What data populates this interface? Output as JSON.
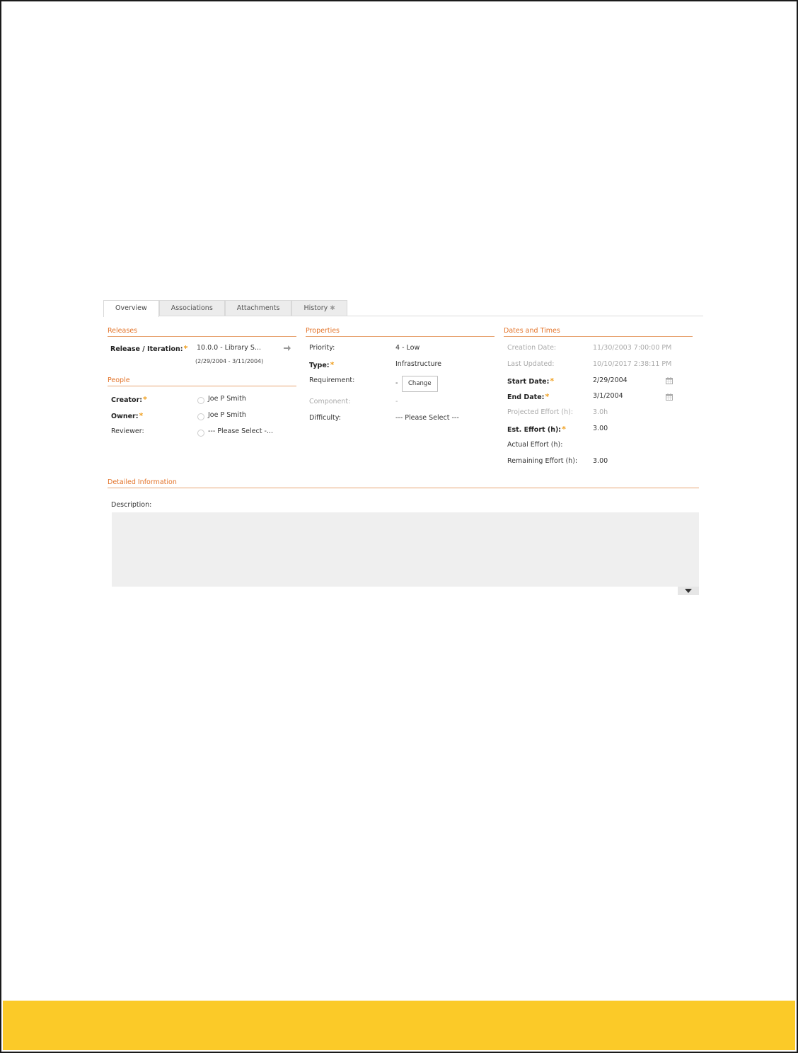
{
  "tabs": [
    {
      "label": "Overview",
      "active": true
    },
    {
      "label": "Associations",
      "active": false
    },
    {
      "label": "Attachments",
      "active": false
    },
    {
      "label": "History",
      "active": false
    }
  ],
  "releases": {
    "title": "Releases",
    "release_label": "Release / Iteration:",
    "release_value": "10.0.0 - Library S...",
    "release_dates": "(2/29/2004 - 3/11/2004)"
  },
  "people": {
    "title": "People",
    "creator_label": "Creator:",
    "creator_value": "Joe P Smith",
    "owner_label": "Owner:",
    "owner_value": "Joe P Smith",
    "reviewer_label": "Reviewer:",
    "reviewer_value": "--- Please Select -..."
  },
  "properties": {
    "title": "Properties",
    "priority_label": "Priority:",
    "priority_value": "4 - Low",
    "type_label": "Type:",
    "type_value": "Infrastructure",
    "requirement_label": "Requirement:",
    "requirement_value": "-",
    "change_button": "Change",
    "component_label": "Component:",
    "component_value": "-",
    "difficulty_label": "Difficulty:",
    "difficulty_value": "--- Please Select ---"
  },
  "dates": {
    "title": "Dates and Times",
    "creation_label": "Creation Date:",
    "creation_value": "11/30/2003 7:00:00 PM",
    "updated_label": "Last Updated:",
    "updated_value": "10/10/2017 2:38:11 PM",
    "start_label": "Start Date:",
    "start_value": "2/29/2004",
    "end_label": "End Date:",
    "end_value": "3/1/2004",
    "projected_label": "Projected Effort (h):",
    "projected_value": "3.0h",
    "est_label": "Est. Effort (h):",
    "est_value": "3.00",
    "actual_label": "Actual Effort (h):",
    "actual_value": "",
    "remaining_label": "Remaining Effort (h):",
    "remaining_value": "3.00"
  },
  "detailed": {
    "title": "Detailed Information",
    "description_label": "Description:",
    "description_value": ""
  },
  "required_marker": "*",
  "colors": {
    "accent": "#e3742a",
    "required": "#f0a020",
    "footer": "#fbca28"
  }
}
